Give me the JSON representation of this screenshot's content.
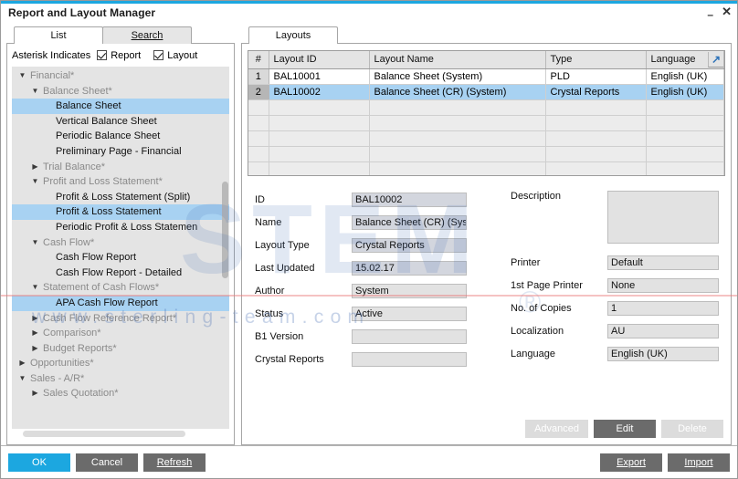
{
  "window": {
    "title": "Report and Layout Manager",
    "minimize_label": "–",
    "close_label": "✕"
  },
  "left_panel": {
    "tabs": [
      {
        "label": "List",
        "active": true
      },
      {
        "label": "Search",
        "active": false
      }
    ],
    "asterisk_label": "Asterisk Indicates",
    "checkboxes": [
      {
        "label": "Report",
        "checked": true
      },
      {
        "label": "Layout",
        "checked": true
      }
    ],
    "tree": [
      {
        "label": "Financial*",
        "indent": 1,
        "arrow": "▼",
        "type": "group",
        "selected": false
      },
      {
        "label": "Balance Sheet*",
        "indent": 2,
        "arrow": "▼",
        "type": "group",
        "selected": false
      },
      {
        "label": "Balance Sheet",
        "indent": 3,
        "arrow": "",
        "type": "leaf",
        "selected": true
      },
      {
        "label": "Vertical Balance Sheet",
        "indent": 3,
        "arrow": "",
        "type": "leaf",
        "selected": false
      },
      {
        "label": "Periodic Balance Sheet",
        "indent": 3,
        "arrow": "",
        "type": "leaf",
        "selected": false
      },
      {
        "label": "Preliminary Page - Financial",
        "indent": 3,
        "arrow": "",
        "type": "leaf",
        "selected": false
      },
      {
        "label": "Trial Balance*",
        "indent": 2,
        "arrow": "▶",
        "type": "group",
        "selected": false
      },
      {
        "label": "Profit and Loss Statement*",
        "indent": 2,
        "arrow": "▼",
        "type": "group",
        "selected": false
      },
      {
        "label": "Profit & Loss Statement (Split)",
        "indent": 3,
        "arrow": "",
        "type": "leaf",
        "selected": false
      },
      {
        "label": "Profit & Loss Statement",
        "indent": 3,
        "arrow": "",
        "type": "leaf",
        "selected": true
      },
      {
        "label": "Periodic Profit & Loss Statemen",
        "indent": 3,
        "arrow": "",
        "type": "leaf",
        "selected": false
      },
      {
        "label": "Cash Flow*",
        "indent": 2,
        "arrow": "▼",
        "type": "group",
        "selected": false
      },
      {
        "label": "Cash Flow Report",
        "indent": 3,
        "arrow": "",
        "type": "leaf",
        "selected": false
      },
      {
        "label": "Cash Flow Report - Detailed",
        "indent": 3,
        "arrow": "",
        "type": "leaf",
        "selected": false
      },
      {
        "label": "Statement of Cash Flows*",
        "indent": 2,
        "arrow": "▼",
        "type": "group",
        "selected": false
      },
      {
        "label": "APA Cash Flow Report",
        "indent": 3,
        "arrow": "",
        "type": "leaf",
        "selected": true
      },
      {
        "label": "Cash Flow Reference Report*",
        "indent": 2,
        "arrow": "▶",
        "type": "group",
        "selected": false
      },
      {
        "label": "Comparison*",
        "indent": 2,
        "arrow": "▶",
        "type": "group",
        "selected": false
      },
      {
        "label": "Budget Reports*",
        "indent": 2,
        "arrow": "▶",
        "type": "group",
        "selected": false
      },
      {
        "label": "Opportunities*",
        "indent": 1,
        "arrow": "▶",
        "type": "group",
        "selected": false
      },
      {
        "label": "Sales - A/R*",
        "indent": 1,
        "arrow": "▼",
        "type": "group",
        "selected": false
      },
      {
        "label": "Sales Quotation*",
        "indent": 2,
        "arrow": "▶",
        "type": "group",
        "selected": false
      }
    ]
  },
  "right_panel": {
    "tabs": [
      {
        "label": "Layouts",
        "active": true
      }
    ],
    "grid": {
      "columns": [
        "#",
        "Layout ID",
        "Layout Name",
        "Type",
        "Language"
      ],
      "rows": [
        {
          "idx": "1",
          "layout_id": "BAL10001",
          "layout_name": "Balance Sheet (System)",
          "type": "PLD",
          "language": "English (UK)",
          "selected": false
        },
        {
          "idx": "2",
          "layout_id": "BAL10002",
          "layout_name": "Balance Sheet (CR) (System)",
          "type": "Crystal Reports",
          "language": "English (UK)",
          "selected": true
        }
      ],
      "empty_row_count": 5,
      "expand_icon": "↗"
    },
    "form_left": [
      {
        "label": "ID",
        "value": "BAL10002",
        "highlight": true
      },
      {
        "label": "Name",
        "value": "Balance Sheet (CR) (Sys",
        "highlight": true
      },
      {
        "label": "Layout Type",
        "value": "Crystal Reports",
        "highlight": true
      },
      {
        "label": "Last Updated",
        "value": "15.02.17",
        "highlight": true
      },
      {
        "label": "Author",
        "value": "System",
        "highlight": false
      },
      {
        "label": "Status",
        "value": "Active",
        "highlight": false
      },
      {
        "label": "B1 Version",
        "value": "",
        "highlight": false
      },
      {
        "label": "Crystal Reports",
        "value": "",
        "highlight": false
      }
    ],
    "form_right": {
      "description_label": "Description",
      "description_value": "",
      "fields": [
        {
          "label": "Printer",
          "value": "Default"
        },
        {
          "label": "1st Page Printer",
          "value": "None"
        },
        {
          "label": "No. of Copies",
          "value": "1"
        },
        {
          "label": "Localization",
          "value": "AU"
        },
        {
          "label": "Language",
          "value": "English (UK)"
        }
      ]
    },
    "actions": [
      {
        "label": "Advanced",
        "state": "disabled"
      },
      {
        "label": "Edit",
        "state": "enabled"
      },
      {
        "label": "Delete",
        "state": "disabled"
      }
    ]
  },
  "footer": {
    "left_buttons": [
      {
        "label": "OK",
        "style": "primary"
      },
      {
        "label": "Cancel",
        "style": "normal"
      },
      {
        "label": "Refresh",
        "style": "normal"
      }
    ],
    "right_buttons": [
      {
        "label": "Export",
        "style": "normal"
      },
      {
        "label": "Import",
        "style": "normal"
      }
    ]
  },
  "watermark": {
    "brand": "STEM",
    "registered": "®",
    "url": "www.sterling-team.com"
  },
  "colors": {
    "accent": "#1ca7e0",
    "selection": "#a8d2f2",
    "button": "#6b6b6b",
    "tree_bg": "#e4e4e4"
  }
}
